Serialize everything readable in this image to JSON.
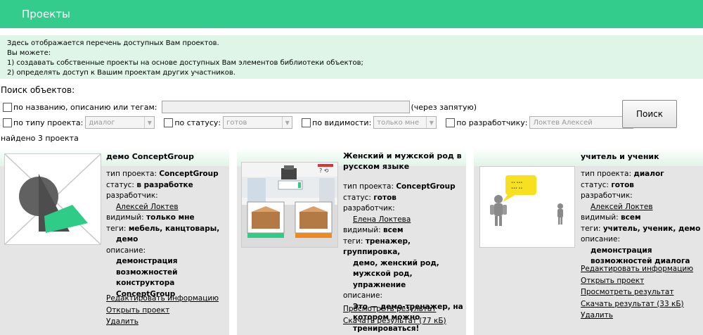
{
  "header": {
    "title": "Проекты"
  },
  "info": {
    "lines": [
      "Здесь отображается перечень доступных Вам проектов.",
      "Вы можете:",
      "1) создавать собственные проекты на основе доступных Вам элементов библиотеки объектов;",
      "2) определять доступ к Вашим проектам других участников."
    ]
  },
  "search": {
    "label": "Поиск объектов:",
    "by_name_label": "по названию, описанию или тегам:",
    "name_value": "",
    "hint": "(через запятую)",
    "type_label": "по типу проекта:",
    "type_value": "диалог",
    "status_label": "по статусу:",
    "status_value": "готов",
    "visibility_label": "по видимости:",
    "visibility_value": "только мне",
    "developer_label": "по разработчику:",
    "developer_value": "Локтев Алексей",
    "button": "Поиск"
  },
  "found_text": "найдено 3 проекта",
  "field_labels": {
    "type": "тип проекта:",
    "status": "статус:",
    "developer": "разработчик:",
    "visible": "видимый:",
    "tags": "теги:",
    "description": "описание:"
  },
  "projects": [
    {
      "title": "демо ConceptGroup",
      "type": "ConceptGroup",
      "status": "в разработке",
      "developer": "Алексей Локтев",
      "visible": "только мне",
      "tags_line1": "мебель, канцтовары,",
      "tags_line2": "демо",
      "desc_lines": [
        "демонстрация",
        "возможностей",
        "конструктора",
        "ConceptGroup"
      ],
      "links": [
        "Редактировать информацию",
        "Открыть проект",
        "Удалить"
      ]
    },
    {
      "title_lines": [
        "Женский и мужской род в",
        "русском языке"
      ],
      "type": "ConceptGroup",
      "status": "готов",
      "developer": "Елена Локтева",
      "visible": "всем",
      "tags_lines": [
        "тренажер, группировка,",
        "демо, женский род,",
        "мужской род, упражнение"
      ],
      "desc_lines": [
        "Это — демо-тренажер, на",
        "котором можно",
        "тренироваться!"
      ],
      "links": [
        "Просмотреть результат",
        "Скачать результат (77 кБ)"
      ]
    },
    {
      "title": "учитель и ученик",
      "type": "диалог",
      "status": "готов",
      "developer": "Алексей Локтев",
      "visible": "всем",
      "tags": "учитель, ученик, демо",
      "desc_lines": [
        "демонстрация",
        "возможностей диалога"
      ],
      "links": [
        "Редактировать информацию",
        "Открыть проект",
        "Просмотреть результат",
        "Скачать результат (33 кБ)",
        "Удалить"
      ]
    }
  ],
  "colors": {
    "accent": "#33cc8c",
    "info_bg": "#dff5e8",
    "card_bg": "#e5e5e5"
  }
}
